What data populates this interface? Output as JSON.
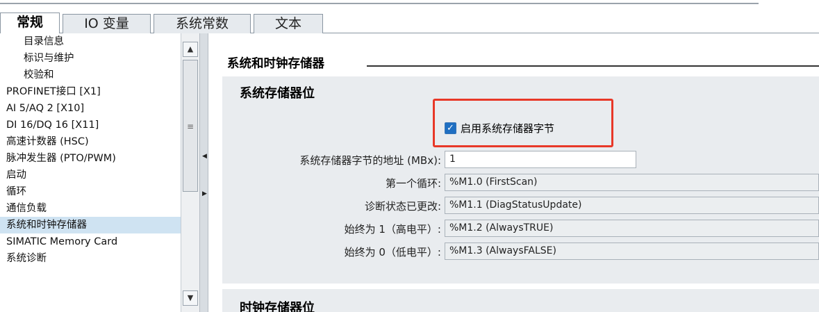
{
  "tabs": [
    {
      "label": "常规",
      "active": true
    },
    {
      "label": "IO 变量",
      "active": false
    },
    {
      "label": "系统常数",
      "active": false
    },
    {
      "label": "文本",
      "active": false
    }
  ],
  "tree": {
    "items": [
      {
        "label": "目录信息"
      },
      {
        "label": "标识与维护"
      },
      {
        "label": "校验和"
      },
      {
        "label": "PROFINET接口 [X1]"
      },
      {
        "label": "AI 5/AQ 2 [X10]"
      },
      {
        "label": "DI 16/DQ 16 [X11]"
      },
      {
        "label": "高速计数器 (HSC)"
      },
      {
        "label": "脉冲发生器 (PTO/PWM)"
      },
      {
        "label": "启动"
      },
      {
        "label": "循环"
      },
      {
        "label": "通信负载"
      },
      {
        "label": "系统和时钟存储器",
        "selected": true
      },
      {
        "label": "SIMATIC Memory Card"
      },
      {
        "label": "系统诊断"
      }
    ]
  },
  "scrollbar": {
    "up": "▲",
    "down": "▼",
    "grip": "≡"
  },
  "splitter": {
    "left": "◀",
    "right": "▶"
  },
  "section": {
    "title": "系统和时钟存储器"
  },
  "system_memory": {
    "title": "系统存储器位",
    "enable_checkbox": {
      "label": "启用系统存储器字节",
      "checked": true,
      "mark": "✓"
    },
    "address": {
      "label": "系统存储器字节的地址 (MBx):",
      "value": "1"
    },
    "rows": [
      {
        "label": "第一个循环:",
        "value": "%M1.0 (FirstScan)"
      },
      {
        "label": "诊断状态已更改:",
        "value": "%M1.1 (DiagStatusUpdate)"
      },
      {
        "label": "始终为 1（高电平）:",
        "value": "%M1.2 (AlwaysTRUE)"
      },
      {
        "label": "始终为 0（低电平）:",
        "value": "%M1.3 (AlwaysFALSE)"
      }
    ]
  },
  "clock_memory": {
    "title": "时钟存储器位"
  },
  "colors": {
    "highlight": "#e83828",
    "selected_bg": "#cfe3f2",
    "panel_bg": "#e9ecef",
    "check_fill": "#1f6fc2"
  }
}
